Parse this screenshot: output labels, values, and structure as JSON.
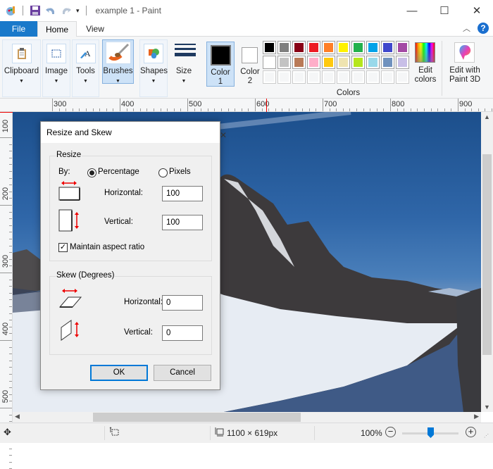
{
  "window": {
    "title": "example 1 - Paint",
    "minimize_icon": "minimize-icon",
    "maximize_icon": "maximize-icon",
    "close_icon": "close-icon"
  },
  "quick_access": {
    "app_icon": "paint-app-icon",
    "save_icon": "save-icon",
    "undo_icon": "undo-icon",
    "redo_icon": "redo-icon",
    "customize_icon": "dropdown-arrow-icon"
  },
  "tabs": [
    {
      "label": "File"
    },
    {
      "label": "Home"
    },
    {
      "label": "View"
    }
  ],
  "help": {
    "collapse_icon": "chevron-up-icon",
    "help_label": "?"
  },
  "ribbon": {
    "groups": [
      {
        "label": "Clipboard",
        "icon": "clipboard-icon"
      },
      {
        "label": "Image",
        "icon": "select-icon"
      },
      {
        "label": "Tools",
        "icon": "tools-icon"
      },
      {
        "label": "Brushes",
        "icon": "brush-icon"
      },
      {
        "label": "Shapes",
        "icon": "shapes-icon"
      },
      {
        "label": "Size",
        "icon": "size-icon"
      }
    ],
    "color1_label": "Color",
    "color1_num": "1",
    "color2_label": "Color",
    "color2_num": "2",
    "color1_value": "#000000",
    "color2_value": "#ffffff",
    "colors_label": "Colors",
    "palette_row1": [
      "#000000",
      "#7f7f7f",
      "#880015",
      "#ed1c24",
      "#ff7f27",
      "#fff200",
      "#22b14c",
      "#00a2e8",
      "#3f48cc",
      "#a349a4"
    ],
    "palette_row2": [
      "#ffffff",
      "#c3c3c3",
      "#b97a57",
      "#ffaec9",
      "#ffc90e",
      "#efe4b0",
      "#b5e61d",
      "#99d9ea",
      "#7092be",
      "#c8bfe7"
    ],
    "edit_colors_line1": "Edit",
    "edit_colors_line2": "colors",
    "paint3d_line1": "Edit with",
    "paint3d_line2": "Paint 3D"
  },
  "ruler": {
    "top": [
      "300",
      "400",
      "500",
      "600",
      "700",
      "800",
      "900"
    ],
    "left": [
      "100",
      "200",
      "300",
      "400",
      "500"
    ]
  },
  "dialog": {
    "title": "Resize and Skew",
    "resize_legend": "Resize",
    "by_label": "By:",
    "percentage_label": "Percentage",
    "pixels_label": "Pixels",
    "percentage_selected": true,
    "horizontal_label": "Horizontal:",
    "horizontal_value": "100",
    "vertical_label": "Vertical:",
    "vertical_value": "100",
    "maintain_label": "Maintain aspect ratio",
    "maintain_checked": true,
    "skew_legend": "Skew (Degrees)",
    "skew_horizontal_label": "Horizontal:",
    "skew_horizontal_value": "0",
    "skew_vertical_label": "Vertical:",
    "skew_vertical_value": "0",
    "ok_label": "OK",
    "cancel_label": "Cancel"
  },
  "status": {
    "move_icon": "move-icon",
    "selection_icon": "selection-size-icon",
    "image_size_icon": "image-size-icon",
    "image_size": "1100 × 619px",
    "zoom": "100%",
    "zoom_fraction": 0.5
  }
}
